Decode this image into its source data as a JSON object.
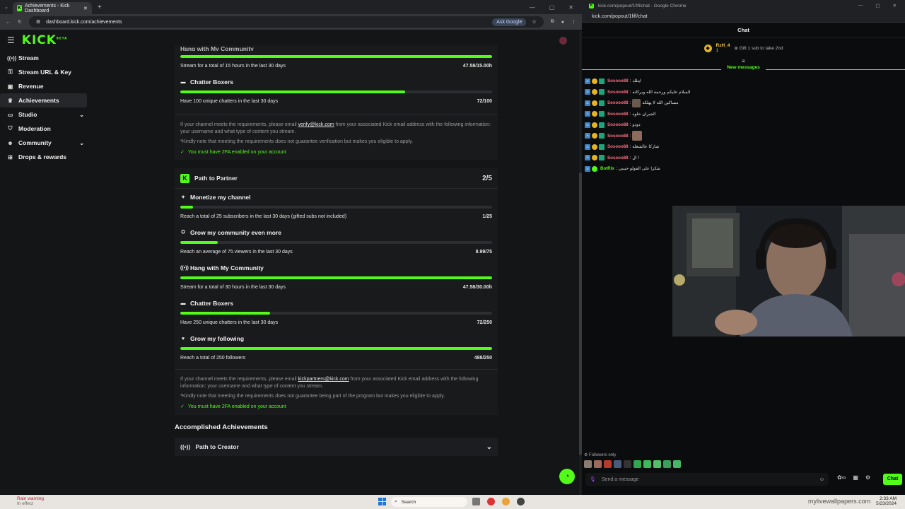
{
  "left_browser": {
    "tab_title": "Achievements - Kick Dashboard",
    "url": "dashboard.kick.com/achievements",
    "ask_google": "Ask Google"
  },
  "sidebar": {
    "logo": "KICK",
    "logo_beta": "BETA",
    "items": [
      {
        "label": "Stream",
        "icon": "broadcast-icon"
      },
      {
        "label": "Stream URL & Key",
        "icon": "key-icon"
      },
      {
        "label": "Revenue",
        "icon": "revenue-icon"
      },
      {
        "label": "Achievements",
        "icon": "trophy-icon"
      },
      {
        "label": "Studio",
        "icon": "studio-icon"
      },
      {
        "label": "Moderation",
        "icon": "shield-icon"
      },
      {
        "label": "Community",
        "icon": "people-icon"
      },
      {
        "label": "Drops & rewards",
        "icon": "gift-icon"
      }
    ]
  },
  "verified": {
    "partial_title": "Hang with My Community",
    "hang": {
      "progress": 1.0,
      "desc": "Stream for a total of 15 hours in the last 30 days",
      "value": "47.58/15.00h"
    },
    "chatter": {
      "title": "Chatter Boxers",
      "progress": 0.72,
      "desc": "Have 100 unique chatters in the last 30 days",
      "value": "72/100"
    },
    "info_pre": "If your channel meets the requirements, please email ",
    "email": "verify@kick.com",
    "info_post": " from your associated Kick email address with the following information: your username and what type of content you stream.",
    "note": "*Kindly note that meeting the requirements does not guarantee verification but makes you eligible to apply.",
    "twofa": "You must have 2FA enabled on your account"
  },
  "partner": {
    "title": "Path to Partner",
    "count": "2/5",
    "items": [
      {
        "title": "Monetize my channel",
        "icon": "sparkle-icon",
        "progress": 0.04,
        "desc": "Reach a total of 25 subscribers in the last 30 days (gifted subs not included)",
        "value": "1/25"
      },
      {
        "title": "Grow my community even more",
        "icon": "group-icon",
        "progress": 0.12,
        "desc": "Reach an average of 75 viewers in the last 30 days",
        "value": "8.99/75"
      },
      {
        "title": "Hang with My Community",
        "icon": "signal-icon",
        "progress": 1.0,
        "desc": "Stream for a total of 30 hours in the last 30 days",
        "value": "47.58/30.00h"
      },
      {
        "title": "Chatter Boxers",
        "icon": "chat-icon",
        "progress": 0.288,
        "desc": "Have 250 unique chatters in the last 30 days",
        "value": "72/250"
      },
      {
        "title": "Grow my following",
        "icon": "heart-icon",
        "progress": 1.0,
        "desc": "Reach a total of 250 followers",
        "value": "488/250"
      }
    ],
    "info_pre": "If your channel meets the requirements, please email ",
    "email": "kickpartners@kick.com",
    "info_post": " from your associated Kick email address with the following information: your username and what type of content you stream.",
    "note": "*Kindly note that meeting the requirements does not guarantee being part of the program but makes you eligible to apply.",
    "twofa": "You must have 2FA enabled on your account"
  },
  "accomplished": {
    "heading": "Accomplished Achievements",
    "item": "Path to Creator"
  },
  "chat_window": {
    "title": "kick.com/popout/1fifl/chat - Google Chrome",
    "url": "kick.com/popout/1fifl/chat",
    "header": "Chat",
    "pinned_user": "RzH_4",
    "pinned_count": "1",
    "pinned_gift": "Gift 1 sub to take 2nd",
    "new_messages": "New messages",
    "messages": [
      {
        "user": "Sosooo88",
        "text": "ايتلك"
      },
      {
        "user": "Sosooo88",
        "text": "السلام عليكم ورحمة الله وبركاته"
      },
      {
        "user": "Sosooo88",
        "text": "مساكين الله لا يهلكه",
        "emote": true
      },
      {
        "user": "Sosooo88",
        "text": "الجيران حلوه"
      },
      {
        "user": "Sosooo88",
        "text": "دودو"
      },
      {
        "user": "Sosooo88",
        "text": "",
        "emote": true
      },
      {
        "user": "Sosooo88",
        "text": "شاركا عالشغله"
      },
      {
        "user": "Sosooo88",
        "text": "ال !"
      },
      {
        "user": "BotRix",
        "text": "شكرا على الفولو حبيبي"
      }
    ],
    "followers_only": "Followers only",
    "input_placeholder": "Send a message",
    "chat_button": "Chat"
  },
  "taskbar": {
    "weather_line1": "Rain warning",
    "weather_line2": "In effect",
    "search": "Search",
    "time": "2:33 AM",
    "date": "5/23/2024",
    "watermark": "mylivewallpapers.com"
  }
}
